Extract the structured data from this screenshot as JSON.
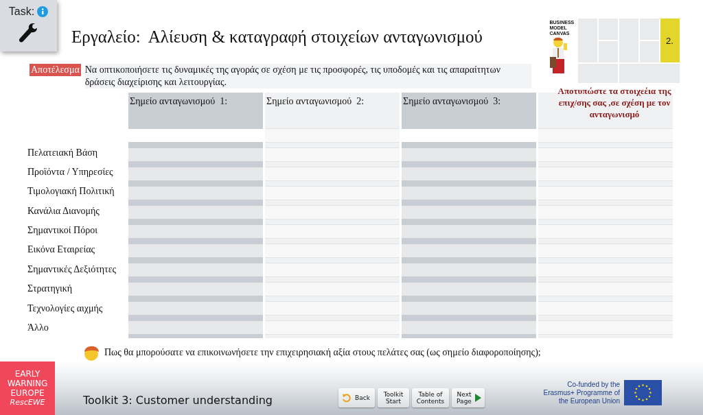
{
  "task_card": {
    "label": "Task:"
  },
  "title": "Εργαλείο:  Αλίευση & καταγραφή στοιχείων ανταγωνισμού",
  "canvas_thumbnail": {
    "caption": "BUSINESS MODEL CANVAS",
    "block_number": "2.",
    "note": "Αποτυπώστε τα στοιχεέια της επιχ/σης σας ,σε σχέση με τον ανταγωνισμό"
  },
  "result": {
    "tag": "Αποτέλεσμα",
    "text": "Να οπτικοποιήσετε τις δυναμικές της αγοράς σε σχέση με τις προσφορές, τις υποδομές και τις απαραίτητων δράσεις  διαχείρισης και λειτουργίας."
  },
  "table": {
    "columns": [
      {
        "header": "Σημείο ανταγωνισμού  1:",
        "shaded": true
      },
      {
        "header": "Σημείο ανταγωνισμού  2:",
        "shaded": false
      },
      {
        "header": "Σημείο ανταγωνισμού  3:",
        "shaded": true
      },
      {
        "shaded": false
      }
    ],
    "rows": [
      "Πελατειακή Βάση",
      "Προϊόντα / Υπηρεσίες",
      "Τιμολογιακή Πολιτική",
      "Κανάλια Διανομής",
      "Σημαντικοί Πόροι",
      "Εικόνα Εταιρείας",
      "Σημαντικές Δεξιότητες",
      "Στρατηγική",
      "Τεχνολογίες αιχμής",
      "Άλλο"
    ]
  },
  "question": "Πως θα μπορούσατε να επικοινωνήσετε την επιχειρησιακή αξία στους πελάτες σας (ως σημείο διαφοροποίησης);",
  "footer": {
    "logo": [
      "EARLY",
      "WARNING",
      "EUROPE",
      "RescEWE"
    ],
    "toolkit_title": "Toolkit 3: Customer understanding",
    "buttons": [
      {
        "kind": "back",
        "label": "Back"
      },
      {
        "kind": "plain",
        "label": "Toolkit Start"
      },
      {
        "kind": "plain",
        "label": "Table of Contents"
      },
      {
        "kind": "next",
        "label": "Next Page"
      }
    ],
    "funding": "Co-funded by the Erasmus+ Programme of the European Union"
  }
}
